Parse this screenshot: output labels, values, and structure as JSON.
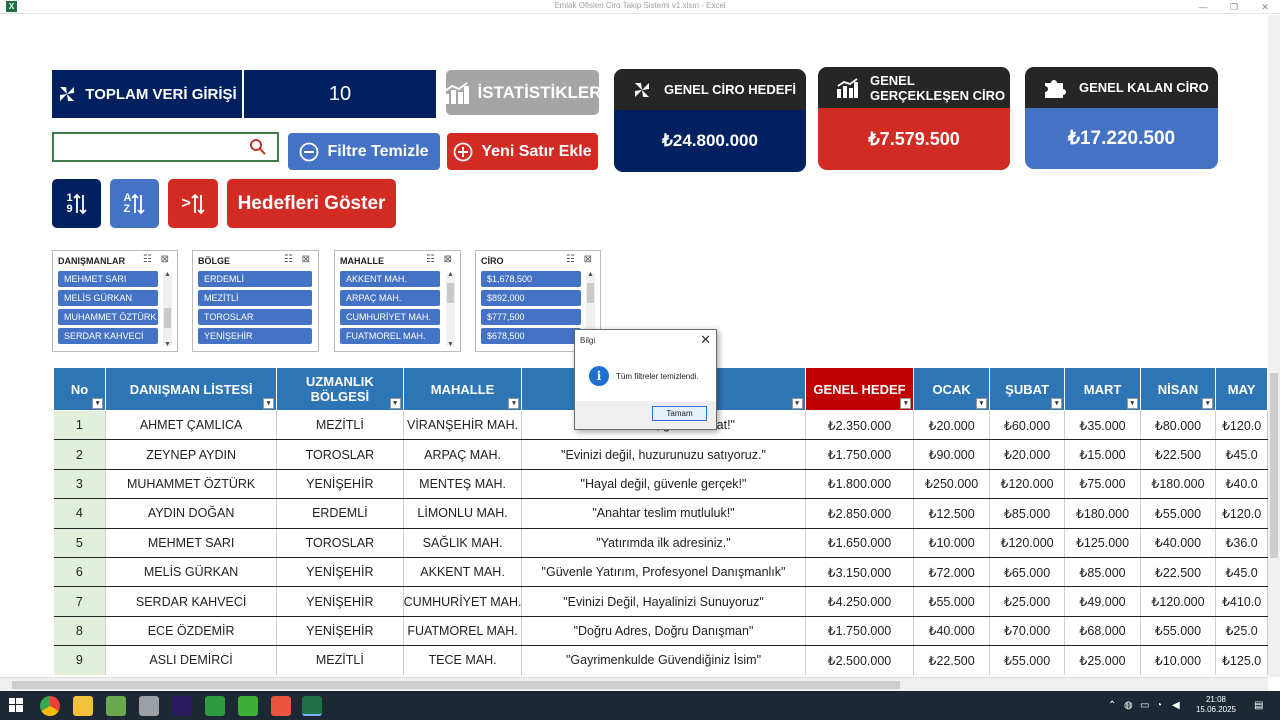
{
  "window": {
    "title": "Emlak Ofisleri Ciro Takip Sistemi v1.xlsm - Excel",
    "app_icon": "X"
  },
  "window_controls": {
    "minimize": "—",
    "restore": "❐",
    "close": "✕"
  },
  "stats_bar": {
    "label": "TOPLAM VERİ GİRİŞİ",
    "value": "10",
    "stats_button": "İSTATİSTİKLER"
  },
  "search": {
    "value": "",
    "placeholder": ""
  },
  "buttons": {
    "filter_clear": "Filtre Temizle",
    "new_row": "Yeni Satır Ekle",
    "sort_num_top": "1",
    "sort_num_bot": "9",
    "sort_alpha_top": "A",
    "sort_alpha_bot": "Z",
    "compare_sym": ">",
    "show_targets": "Hedefleri Göster"
  },
  "cards": [
    {
      "title": "GENEL CİRO HEDEFİ",
      "value": "₺24.800.000",
      "color": "#002060"
    },
    {
      "title": "GENEL GERÇEKLEŞEN CİRO",
      "value": "₺7.579.500",
      "color": "#d12b24"
    },
    {
      "title": "GENEL KALAN CİRO",
      "value": "₺17.220.500",
      "color": "#4472c4"
    }
  ],
  "slicers": [
    {
      "title": "DANIŞMANLAR",
      "items": [
        "MEHMET SARI",
        "MELİS GÜRKAN",
        "MUHAMMET ÖZTÜRK",
        "SERDAR KAHVECİ"
      ]
    },
    {
      "title": "BÖLGE",
      "items": [
        "ERDEMLİ",
        "MEZİTLİ",
        "TOROSLAR",
        "YENİŞEHİR"
      ]
    },
    {
      "title": "MAHALLE",
      "items": [
        "AKKENT MAH.",
        "ARPAÇ MAH.",
        "CUMHURİYET MAH.",
        "FUATMOREL MAH."
      ]
    },
    {
      "title": "CİRO",
      "items": [
        "$1,678,500",
        "$892,000",
        "$777,500",
        "$678,500"
      ]
    }
  ],
  "table": {
    "headers": [
      "No",
      "DANIŞMAN LİSTESİ",
      "UZMANLIK BÖLGESİ",
      "MAHALLE",
      "",
      "GENEL HEDEF",
      "OCAK",
      "ŞUBAT",
      "MART",
      "NİSAN",
      "MAY"
    ],
    "rows": [
      [
        "1",
        "AHMET ÇAMLICA",
        "MEZİTLİ",
        "VİRANŞEHİR MAH.",
        "\"Güvenle al, güvenle sat!\"",
        "₺2.350.000",
        "₺20.000",
        "₺60.000",
        "₺35.000",
        "₺80.000",
        "₺120.0"
      ],
      [
        "2",
        "ZEYNEP AYDIN",
        "TOROSLAR",
        "ARPAÇ MAH.",
        "\"Evinizi değil, huzurunuzu satıyoruz.\"",
        "₺1.750.000",
        "₺90.000",
        "₺20.000",
        "₺15.000",
        "₺22.500",
        "₺45.0"
      ],
      [
        "3",
        "MUHAMMET ÖZTÜRK",
        "YENİŞEHİR",
        "MENTEŞ MAH.",
        "\"Hayal değil, güvenle gerçek!\"",
        "₺1.800.000",
        "₺250.000",
        "₺120.000",
        "₺75.000",
        "₺180.000",
        "₺40.0"
      ],
      [
        "4",
        "AYDIN DOĞAN",
        "ERDEMLİ",
        "LİMONLU MAH.",
        "\"Anahtar teslim mutluluk!\"",
        "₺2.850.000",
        "₺12.500",
        "₺85.000",
        "₺180.000",
        "₺55.000",
        "₺120.0"
      ],
      [
        "5",
        "MEHMET SARI",
        "TOROSLAR",
        "SAĞLIK MAH.",
        "\"Yatırımda ilk adresiniz.\"",
        "₺1.650.000",
        "₺10.000",
        "₺120.000",
        "₺125.000",
        "₺40.000",
        "₺36.0"
      ],
      [
        "6",
        "MELİS GÜRKAN",
        "YENİŞEHİR",
        "AKKENT MAH.",
        "\"Güvenle Yatırım, Profesyonel Danışmanlık\"",
        "₺3.150.000",
        "₺72.000",
        "₺65.000",
        "₺85.000",
        "₺22.500",
        "₺45.0"
      ],
      [
        "7",
        "SERDAR KAHVECİ",
        "YENİŞEHİR",
        "CUMHURİYET MAH.",
        "\"Evinizi Değil, Hayalinizi Sunuyoruz\"",
        "₺4.250.000",
        "₺55.000",
        "₺25.000",
        "₺49.000",
        "₺120.000",
        "₺410.0"
      ],
      [
        "8",
        "ECE ÖZDEMİR",
        "YENİŞEHİR",
        "FUATMOREL MAH.",
        "\"Doğru Adres, Doğru Danışman\"",
        "₺1.750.000",
        "₺40.000",
        "₺70.000",
        "₺68.000",
        "₺55.000",
        "₺25.0"
      ],
      [
        "9",
        "ASLI DEMİRCİ",
        "MEZİTLİ",
        "TECE MAH.",
        "\"Gayrimenkulde Güvendiğiniz İsim\"",
        "₺2.500.000",
        "₺22.500",
        "₺55.000",
        "₺25.000",
        "₺10.000",
        "₺125.0"
      ]
    ]
  },
  "dialog": {
    "title": "Bilgi",
    "message": "Tüm filtreler temizlendi.",
    "ok": "Tamam",
    "info_glyph": "i",
    "close_glyph": "✕"
  },
  "taskbar": {
    "time": "21:08",
    "date": "15.06.2025"
  }
}
